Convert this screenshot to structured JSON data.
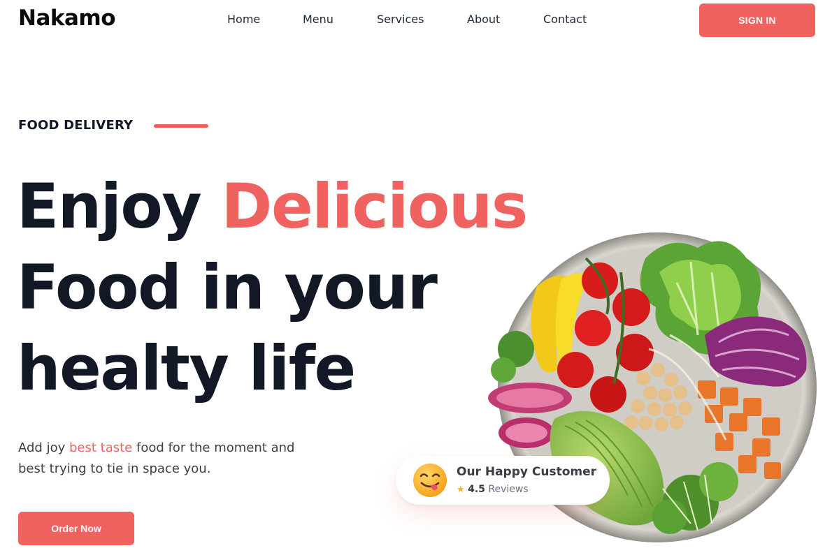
{
  "header": {
    "logo": "Nakamo",
    "nav": [
      "Home",
      "Menu",
      "Services",
      "About",
      "Contact"
    ],
    "signin_label": "SIGN IN"
  },
  "hero": {
    "eyebrow": "FOOD DELIVERY",
    "headline": {
      "word1": "Enjoy",
      "accent": "Delicious",
      "line2": "Food in your",
      "line3": "healty life"
    },
    "lead": {
      "prefix": "Add joy",
      "accent": "best taste",
      "suffix": "food for the moment and best trying to tie in space you."
    },
    "cta_label": "Order Now"
  },
  "review_card": {
    "title": "Our Happy Customer",
    "rating": "4.5",
    "rating_suffix": "Reviews"
  },
  "icons": {
    "rating": "star-icon",
    "avatar": "smiling-face-emoji",
    "eyebrow_decoration": "accent-line"
  },
  "colors": {
    "accent": "#ef625f",
    "heading": "#121826",
    "star": "#f6b019"
  }
}
